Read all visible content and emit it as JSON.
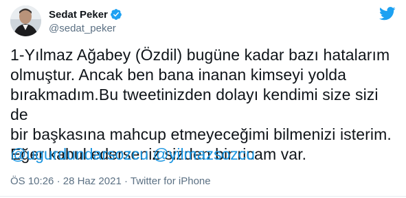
{
  "author": {
    "display_name": "Sedat Peker",
    "handle": "@sedat_peker",
    "verified": true,
    "avatar_icon": "avatar-photo"
  },
  "logo_icon": "twitter-bird-icon",
  "tweet": {
    "text": "1-Yılmaz Ağabey (Özdil) bugüne kadar bazı hatalarım\nolmuştur. Ancak ben bana inanan kimseyi yolda\nbırakmadım.Bu tweetinizden dolayı kendimi size sizi de\nbir başkasına mahcup etmeyeceğimi bilmenizi isterim.\nEğer kabul ederseniz sizden bir ricam var.",
    "mentions": [
      "@ugurdundarsozcu",
      "@yilmazsozcu"
    ]
  },
  "meta": {
    "time": "ÖS 10:26",
    "separator": "·",
    "date": "28 Haz 2021",
    "source": "Twitter for iPhone"
  },
  "colors": {
    "link": "#1b95e0",
    "secondary": "#5b7083",
    "verified_badge": "#1da1f2"
  }
}
